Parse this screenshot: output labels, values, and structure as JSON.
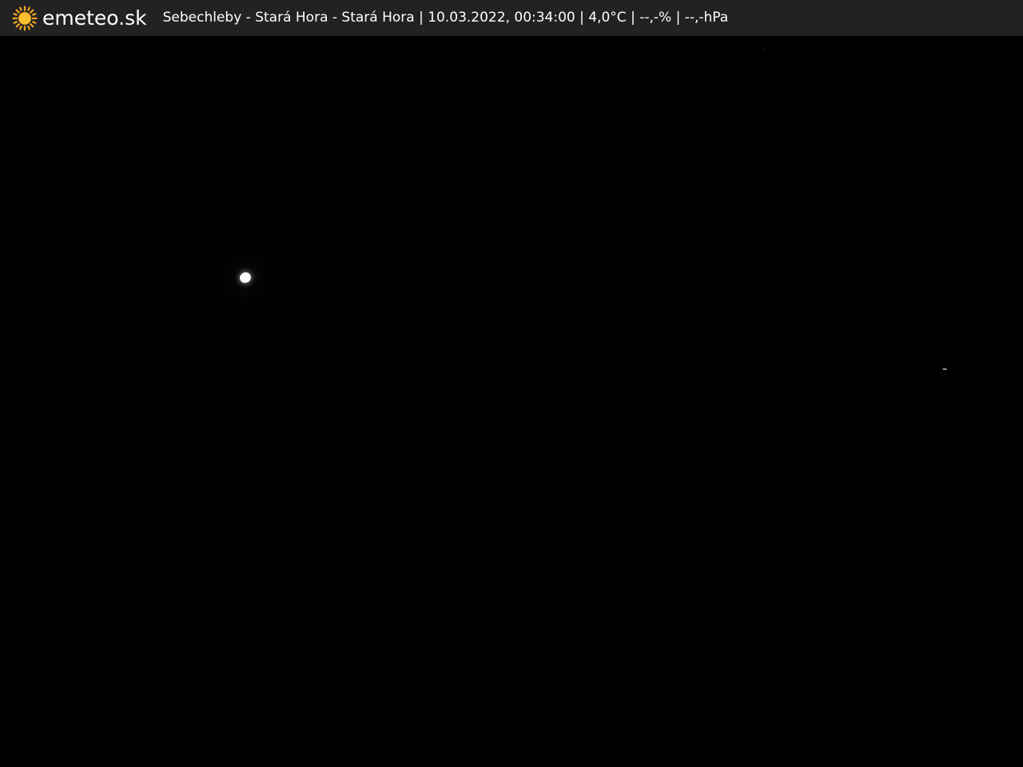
{
  "header": {
    "brand": "emeteo.sk",
    "caption": "Sebechleby - Stará Hora - Stará Hora | 10.03.2022, 00:34:00 | 4,0°C | --,-% | --,-hPa",
    "logo_icon": "sun-icon"
  },
  "colors": {
    "bar_background": "#222222",
    "sky": "#000000",
    "sun": "#f5a623"
  }
}
